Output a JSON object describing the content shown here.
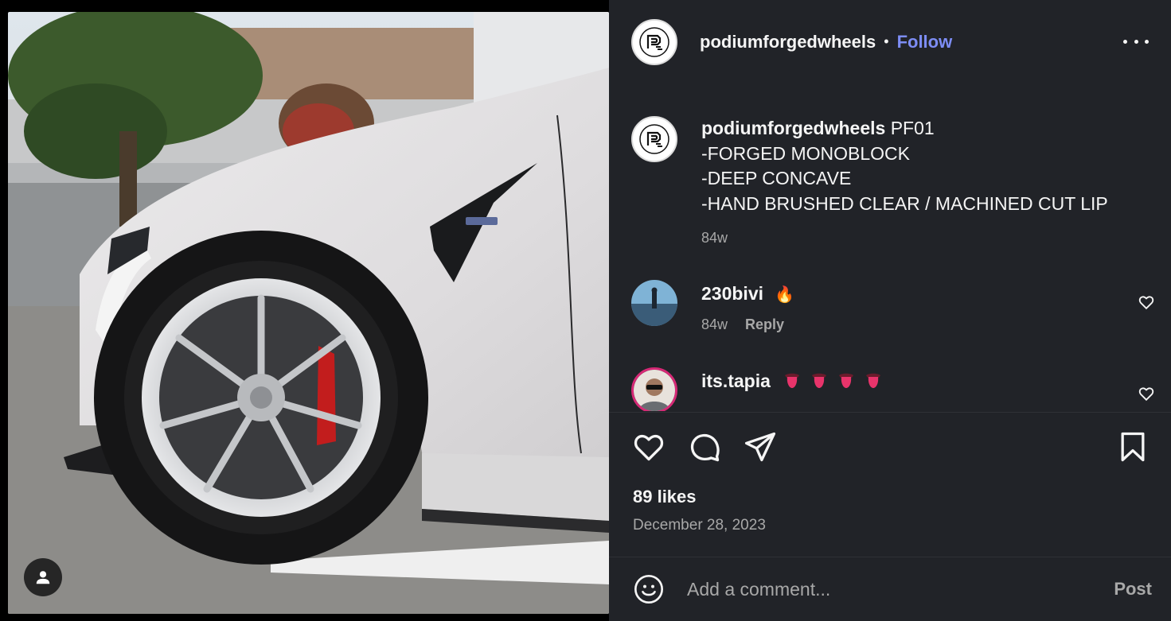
{
  "post": {
    "author": "podiumforgedwheels",
    "separator": "•",
    "follow_label": "Follow",
    "more_icon": "more-horizontal-icon"
  },
  "caption": {
    "author": "podiumforgedwheels",
    "text_first": "PF01",
    "lines": [
      "-FORGED MONOBLOCK",
      "-DEEP CONCAVE",
      "-HAND BRUSHED CLEAR / MACHINED CUT LIP"
    ],
    "age": "84w"
  },
  "comments": [
    {
      "user": "230bivi",
      "text": "🔥",
      "age": "84w",
      "reply_label": "Reply"
    },
    {
      "user": "its.tapia",
      "text": "👅👅👅👅"
    }
  ],
  "actions": {
    "like_icon": "heart-icon",
    "comment_icon": "comment-icon",
    "share_icon": "send-icon",
    "save_icon": "bookmark-icon"
  },
  "likes": "89 likes",
  "date": "December 28, 2023",
  "comment_box": {
    "placeholder": "Add a comment...",
    "post_label": "Post"
  },
  "colors": {
    "panel_bg": "#212328",
    "link_blue": "#7d8df5",
    "muted": "#a8a8a8"
  }
}
